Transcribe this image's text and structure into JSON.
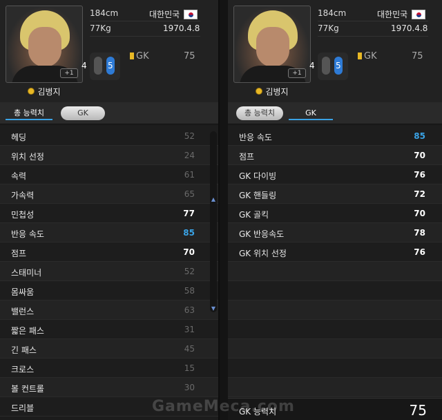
{
  "left": {
    "player": {
      "name": "김병지",
      "height": "184cm",
      "weight": "77Kg",
      "country": "대한민국",
      "birth": "1970.4.8",
      "badge": "+1",
      "foot_left": "4",
      "foot_right": "5",
      "position": "GK",
      "position_rating": "75"
    },
    "tabs": {
      "total": "총 능력치",
      "gk": "GK",
      "active": "total"
    },
    "stats": [
      {
        "label": "헤딩",
        "value": "52",
        "state": "dim"
      },
      {
        "label": "위치 선정",
        "value": "24",
        "state": "dim"
      },
      {
        "label": "속력",
        "value": "61",
        "state": "dim"
      },
      {
        "label": "가속력",
        "value": "65",
        "state": "dim"
      },
      {
        "label": "민첩성",
        "value": "77",
        "state": "bright"
      },
      {
        "label": "반응 속도",
        "value": "85",
        "state": "blue"
      },
      {
        "label": "점프",
        "value": "70",
        "state": "bright"
      },
      {
        "label": "스태미너",
        "value": "52",
        "state": "dim"
      },
      {
        "label": "몸싸움",
        "value": "58",
        "state": "dim"
      },
      {
        "label": "밸런스",
        "value": "63",
        "state": "dim"
      },
      {
        "label": "짧은 패스",
        "value": "31",
        "state": "dim"
      },
      {
        "label": "긴 패스",
        "value": "45",
        "state": "dim"
      },
      {
        "label": "크로스",
        "value": "15",
        "state": "dim"
      },
      {
        "label": "볼 컨트롤",
        "value": "30",
        "state": "dim"
      },
      {
        "label": "드리블",
        "value": "",
        "state": "dim"
      }
    ]
  },
  "right": {
    "player": {
      "name": "김병지",
      "height": "184cm",
      "weight": "77Kg",
      "country": "대한민국",
      "birth": "1970.4.8",
      "badge": "+1",
      "foot_left": "4",
      "foot_right": "5",
      "position": "GK",
      "position_rating": "75"
    },
    "tabs": {
      "total": "총 능력치",
      "gk": "GK",
      "active": "gk"
    },
    "stats": [
      {
        "label": "반응 속도",
        "value": "85",
        "state": "blue"
      },
      {
        "label": "점프",
        "value": "70",
        "state": "bright"
      },
      {
        "label": "GK 다이빙",
        "value": "76",
        "state": "bright"
      },
      {
        "label": "GK 핸들링",
        "value": "72",
        "state": "bright"
      },
      {
        "label": "GK 골킥",
        "value": "70",
        "state": "bright"
      },
      {
        "label": "GK 반응속도",
        "value": "78",
        "state": "bright"
      },
      {
        "label": "GK 위치 선정",
        "value": "76",
        "state": "bright"
      },
      {
        "label": "",
        "value": "",
        "state": "dim"
      },
      {
        "label": "",
        "value": "",
        "state": "dim"
      },
      {
        "label": "",
        "value": "",
        "state": "dim"
      },
      {
        "label": "",
        "value": "",
        "state": "dim"
      },
      {
        "label": "",
        "value": "",
        "state": "dim"
      },
      {
        "label": "",
        "value": "",
        "state": "dim"
      },
      {
        "label": "",
        "value": "",
        "state": "dim"
      }
    ],
    "summary": {
      "label": "GK 능력치",
      "value": "75"
    }
  },
  "watermark": "GameMeca.com",
  "colors": {
    "blue_value": "#3aa3e6",
    "dim_value": "#6a6a6a",
    "bright_value": "#ffffff",
    "coin": "#e8b825",
    "foot_active": "#2e7bd6"
  }
}
